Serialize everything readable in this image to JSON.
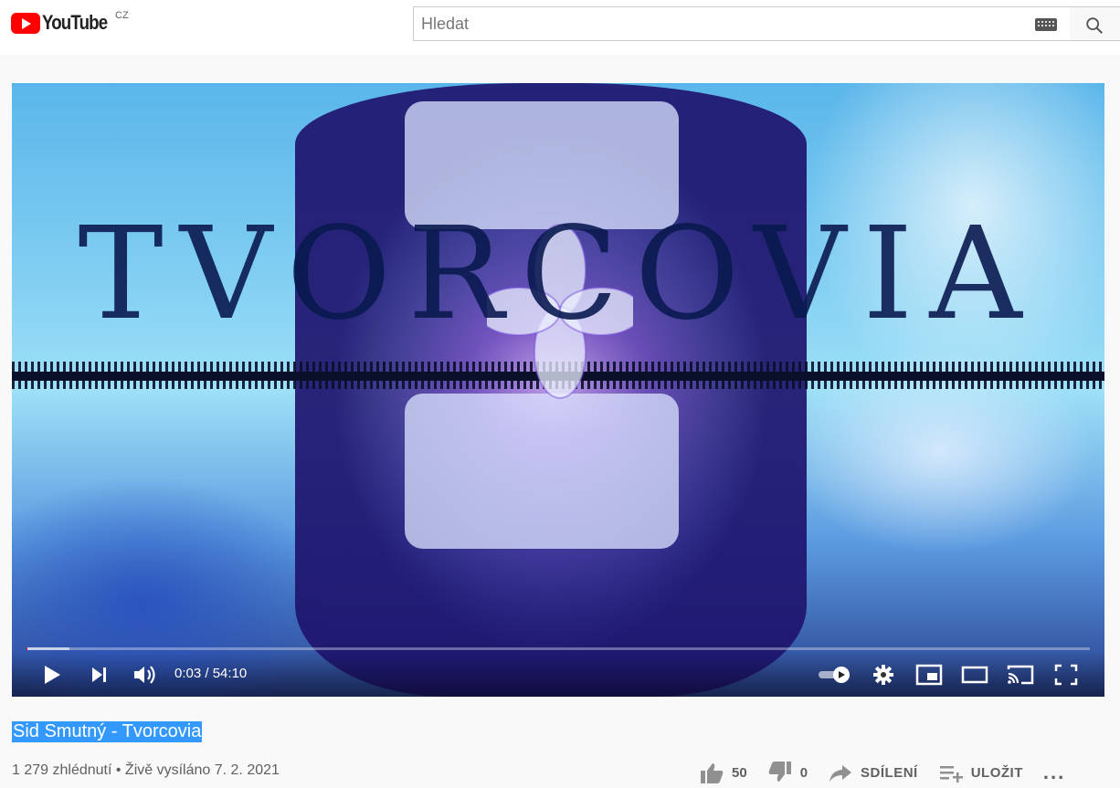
{
  "header": {
    "logo_text": "YouTube",
    "country_code": "CZ",
    "search_placeholder": "Hledat"
  },
  "player": {
    "overlay_title": "TVORCOVIA",
    "time_current": "0:03",
    "time_separator": " / ",
    "time_total": "54:10",
    "progress_played": 0.001,
    "progress_loaded": 0.04
  },
  "video": {
    "title": "Sid Smutný - Tvorcovia",
    "views": "1 279 zhlédnutí",
    "separator": " • ",
    "date": "Živě vysíláno 7. 2. 2021"
  },
  "actions": {
    "likes": "50",
    "dislikes": "0",
    "share_label": "SDÍLENÍ",
    "save_label": "ULOŽIT",
    "more_label": "..."
  },
  "colors": {
    "brand_red": "#ff0000",
    "selection_blue": "#3399ff"
  }
}
